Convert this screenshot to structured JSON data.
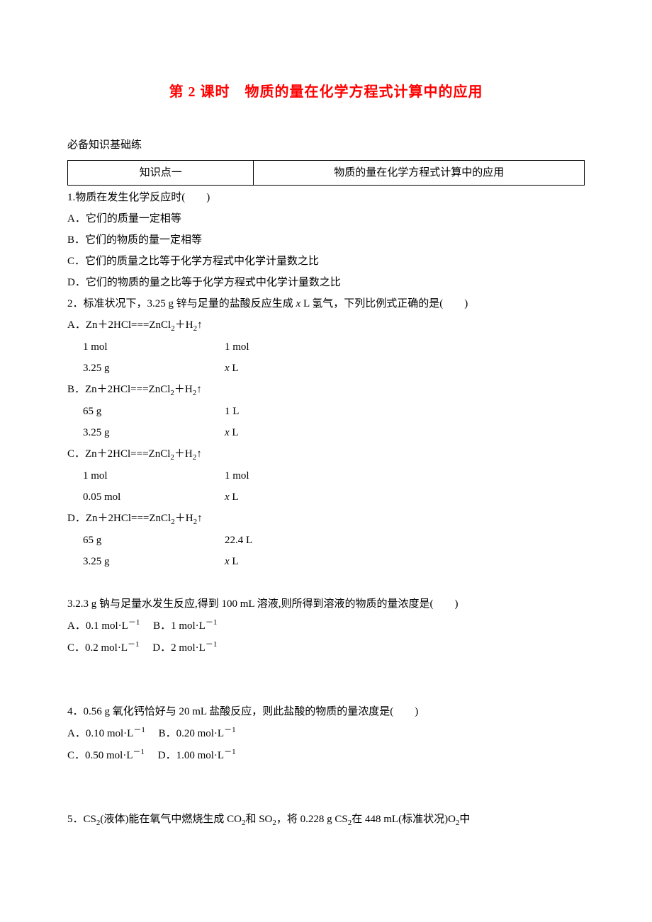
{
  "title": "第 2 课时　物质的量在化学方程式计算中的应用",
  "section_label": "必备知识基础练",
  "kp_table": {
    "left": "知识点一",
    "right": "物质的量在化学方程式计算中的应用"
  },
  "q1": {
    "stem": "1.物质在发生化学反应时(　　)",
    "A": "A．它们的质量一定相等",
    "B": "B．它们的物质的量一定相等",
    "C": "C．它们的质量之比等于化学方程式中化学计量数之比",
    "D": "D．它们的物质的量之比等于化学方程式中化学计量数之比"
  },
  "q2": {
    "stem_a": "2．标准状况下，3.25 g 锌与足量的盐酸反应生成 ",
    "stem_x": "x",
    "stem_b": " L 氢气，下列比例式正确的是(　　)",
    "eq_label_A": "A．Zn＋2HCl===ZnCl",
    "eq_label_B": "B．Zn＋2HCl===ZnCl",
    "eq_label_C": "C．Zn＋2HCl===ZnCl",
    "eq_label_D": "D．Zn＋2HCl===ZnCl",
    "eq_tail": "＋H",
    "arrow": "↑",
    "A": {
      "r1c1": "1 mol",
      "r1c2": "1 mol",
      "r2c1": "3.25 g",
      "r2c2x": "x",
      "r2c2b": " L"
    },
    "B": {
      "r1c1": "65 g",
      "r1c2": "1 L",
      "r2c1": "3.25 g",
      "r2c2x": "x",
      "r2c2b": " L"
    },
    "C": {
      "r1c1": "1 mol",
      "r1c2": "1 mol",
      "r2c1": "0.05 mol",
      "r2c2x": "x",
      "r2c2b": " L"
    },
    "D": {
      "r1c1": "65 g",
      "r1c2": "22.4 L",
      "r2c1": "3.25 g",
      "r2c2x": "x",
      "r2c2b": " L"
    }
  },
  "q3": {
    "stem": "3.2.3 g 钠与足量水发生反应,得到 100 mL 溶液,则所得到溶液的物质的量浓度是(　　)",
    "A": "A．0.1 mol·L",
    "B": "B．1 mol·L",
    "C": "C．0.2 mol·L",
    "D": "D．2 mol·L",
    "exp": "－1"
  },
  "q4": {
    "stem": "4．0.56 g 氧化钙恰好与 20 mL 盐酸反应，则此盐酸的物质的量浓度是(　　)",
    "A": "A．0.10 mol·L",
    "B": "B．0.20 mol·L",
    "C": "C．0.50 mol·L",
    "D": "D．1.00 mol·L",
    "exp": "－1"
  },
  "q5": {
    "a": "5．CS",
    "b": "(液体)能在氧气中燃烧生成 CO",
    "c": "和 SO",
    "d": "，将 0.228 g CS",
    "e": "在 448 mL(标准状况)O",
    "f": "中"
  },
  "sub2": "2"
}
